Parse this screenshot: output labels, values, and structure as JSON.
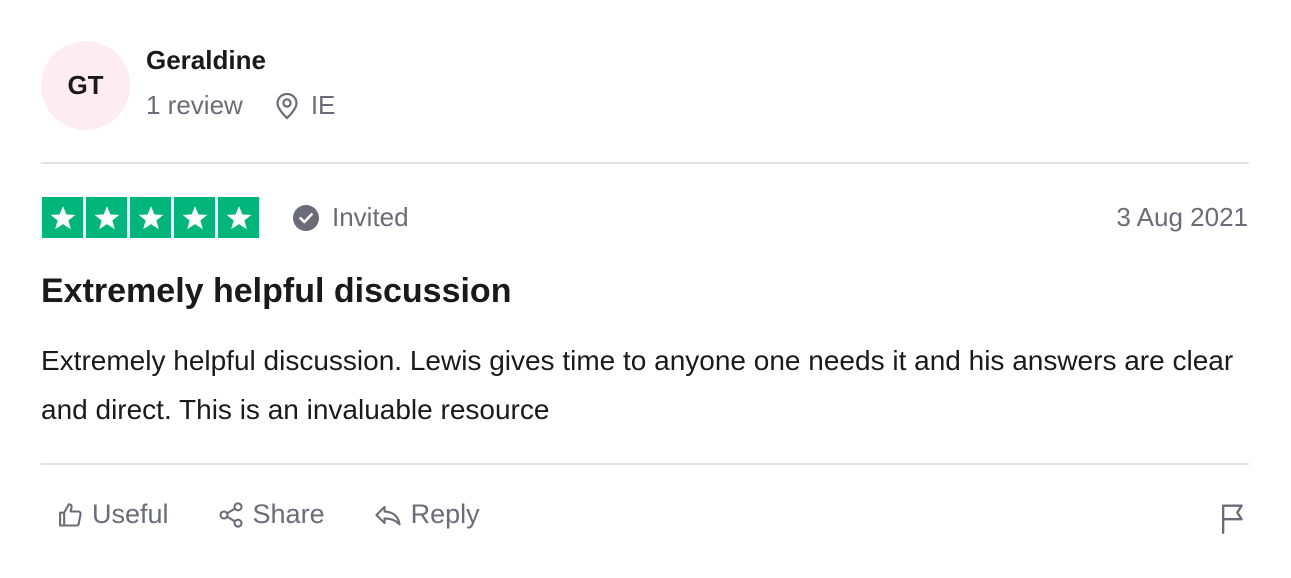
{
  "consumer": {
    "initials": "GT",
    "name": "Geraldine",
    "review_count": "1 review",
    "location": "IE",
    "avatar_color": "#fdecf1"
  },
  "review": {
    "rating": 5,
    "rating_max": 5,
    "star_color": "#00b67a",
    "invited_label": "Invited",
    "date": "3 Aug 2021",
    "title": "Extremely helpful discussion",
    "text": "Extremely helpful discussion. Lewis gives time to anyone one needs it and his answers are clear and direct. This is an invaluable resource"
  },
  "actions": {
    "useful_label": "Useful",
    "share_label": "Share",
    "reply_label": "Reply"
  },
  "icons": {
    "location": "location-pin-icon",
    "invited": "checkmark-badge-icon",
    "star": "star-icon",
    "useful": "thumbs-up-icon",
    "share": "share-icon",
    "reply": "reply-icon",
    "flag": "flag-icon"
  }
}
